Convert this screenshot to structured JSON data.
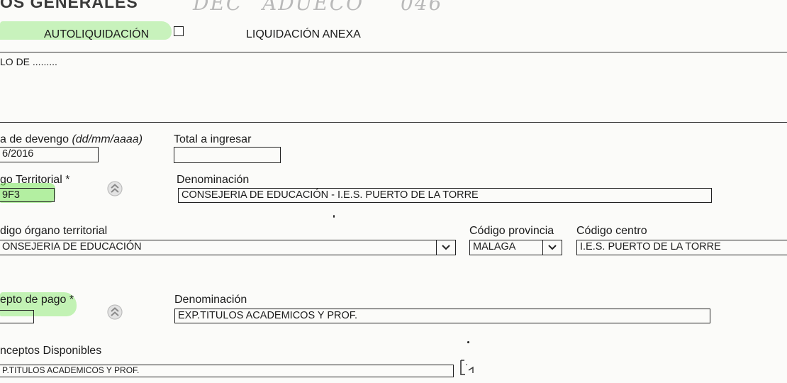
{
  "header": {
    "section_title": "OS GENERALES",
    "hand_notes": [
      "DEC",
      "ADUECO",
      "046"
    ]
  },
  "liquidacion": {
    "auto_label": "AUTOLIQUIDACIÓN",
    "anexa_label": "LIQUIDACIÓN ANEXA"
  },
  "modelo": {
    "label": "LO DE ........."
  },
  "fecha_devengo": {
    "label": "a de devengo",
    "format_hint": "(dd/mm/aaaa)",
    "value": "6/2016"
  },
  "total": {
    "label": "Total a ingresar",
    "value": ""
  },
  "codigo_territorial": {
    "label": "go Territorial *",
    "value": "9F3",
    "denominacion_label": "Denominación",
    "denominacion_value": "CONSEJERIA DE EDUCACIÓN - I.E.S. PUERTO DE LA TORRE"
  },
  "organo": {
    "label": "digo órgano territorial",
    "value": "ONSEJERIA DE EDUCACIÓN"
  },
  "provincia": {
    "label": "Código provincia",
    "value": "MALAGA"
  },
  "centro": {
    "label": "Código centro",
    "value": "I.E.S. PUERTO DE LA TORRE"
  },
  "concepto": {
    "label": "epto de pago *",
    "value": "",
    "denominacion_label": "Denominación",
    "denominacion_value": "EXP.TITULOS ACADEMICOS Y PROF."
  },
  "disponibles": {
    "label": "nceptos Disponibles",
    "value": "P.TITULOS ACADEMICOS Y PROF."
  },
  "colors": {
    "highlighter": "#78e65a",
    "ink": "#1c1c1c"
  },
  "icons": [
    "chevron-up-circle-icon",
    "chevron-down-icon",
    "checkbox-icon"
  ]
}
